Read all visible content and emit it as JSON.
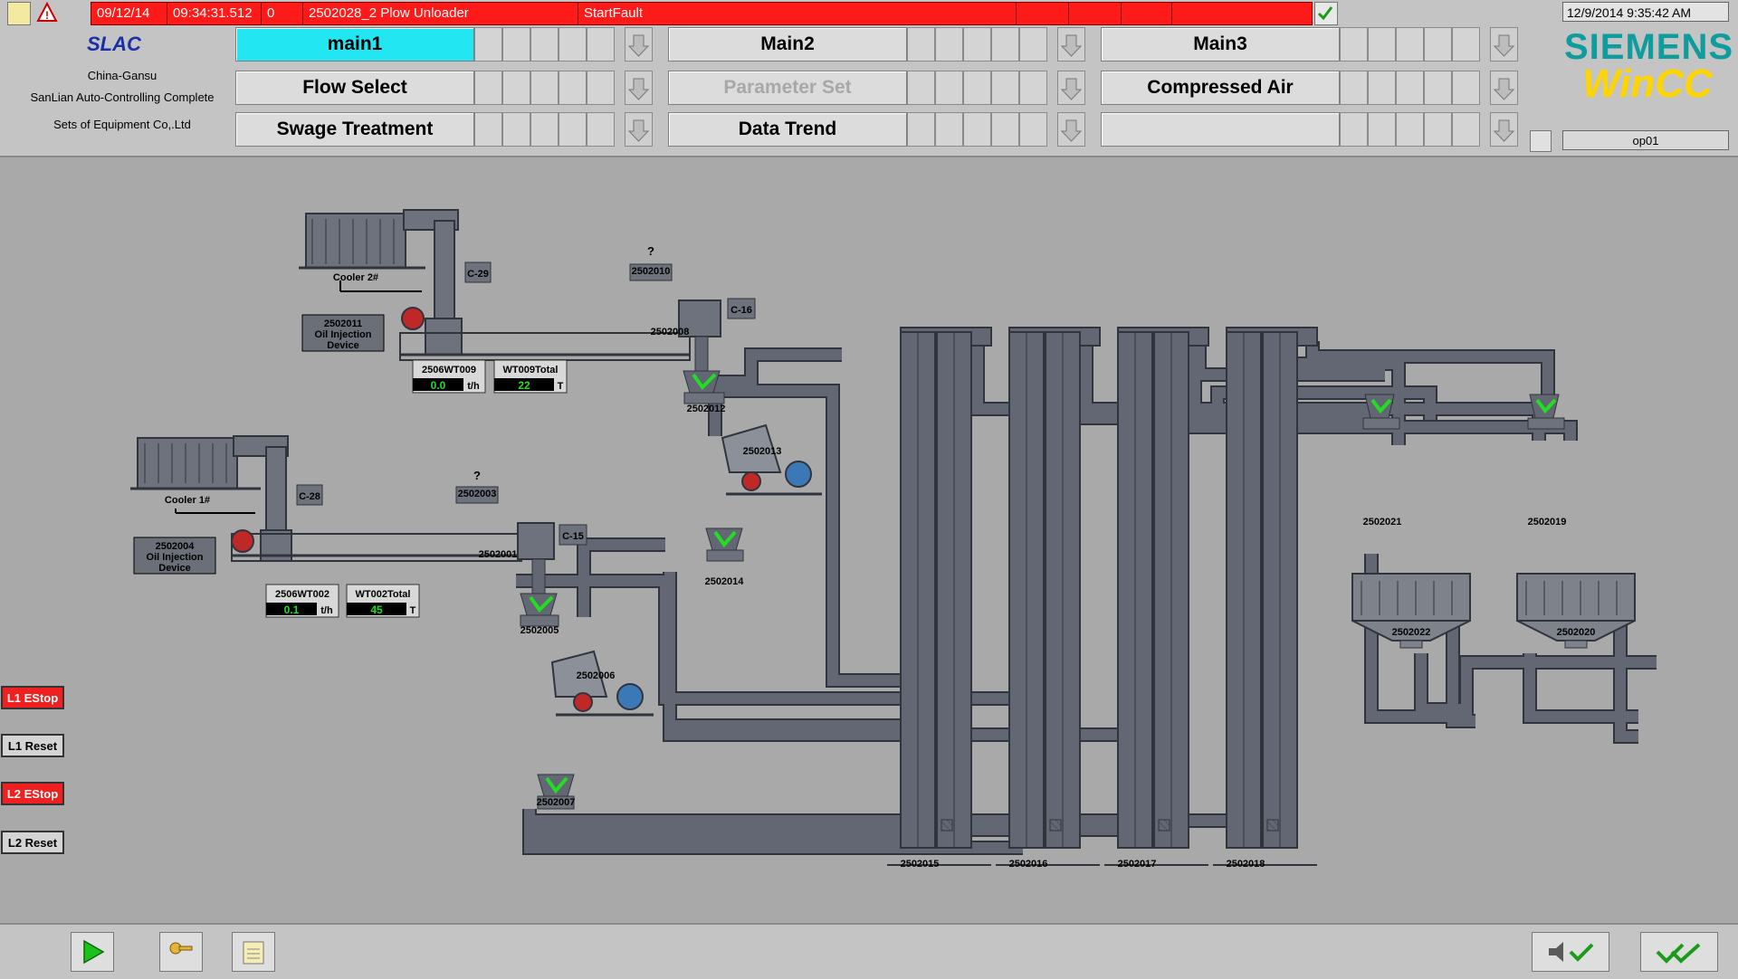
{
  "alarm_bar": {
    "date": "09/12/14",
    "time": "09:34:31.512",
    "state": "0",
    "message": "2502028_2 Plow Unloader",
    "event": "StartFault"
  },
  "branding": {
    "logo": "SLAC",
    "company_line1": "China-Gansu",
    "company_line2": "SanLian Auto-Controlling Complete",
    "company_line3": "Sets of Equipment Co,.Ltd",
    "vendor": "SIEMENS",
    "product": "WinCC"
  },
  "nav": {
    "main1": "main1",
    "main2": "Main2",
    "main3": "Main3",
    "flow_select": "Flow Select",
    "parameter_set": "Parameter Set",
    "compressed_air": "Compressed Air",
    "swage_treatment": "Swage Treatment",
    "data_trend": "Data Trend"
  },
  "system": {
    "datetime": "12/9/2014 9:35:42 AM",
    "station": "op01"
  },
  "process": {
    "cooler2": "Cooler 2#",
    "cooler1": "Cooler 1#",
    "c29": "C-29",
    "c28": "C-28",
    "c16": "C-16",
    "c15": "C-15",
    "oil2_id": "2502011",
    "oil2_l1": "Oil Injection",
    "oil2_l2": "Device",
    "oil1_id": "2502004",
    "oil1_l1": "Oil Injection",
    "oil1_l2": "Device",
    "wt009_label": "2506WT009",
    "wt009_value": "0.0",
    "wt009_unit": "t/h",
    "wt009t_label": "WT009Total",
    "wt009t_value": "22",
    "wt009t_unit": "T",
    "wt002_label": "2506WT002",
    "wt002_value": "0.1",
    "wt002_unit": "t/h",
    "wt002t_label": "WT002Total",
    "wt002t_value": "45",
    "wt002t_unit": "T",
    "q_mark": "?",
    "d2502010": "2502010",
    "d2502008": "2502008",
    "d2502012": "2502012",
    "d2502013": "2502013",
    "d2502014": "2502014",
    "d2502003": "2502003",
    "d2502001": "2502001",
    "d2502005": "2502005",
    "d2502006": "2502006",
    "d2502007": "2502007",
    "d2502015": "2502015",
    "d2502016": "2502016",
    "d2502017": "2502017",
    "d2502018": "2502018",
    "d2502021": "2502021",
    "d2502019": "2502019",
    "d2502022": "2502022",
    "d2502020": "2502020"
  },
  "side_buttons": {
    "l1_estop": "L1 EStop",
    "l1_reset": "L1 Reset",
    "l2_estop": "L2 EStop",
    "l2_reset": "L2 Reset"
  },
  "colors": {
    "alarm": "#ff1a1a",
    "active_tab": "#22e6f2",
    "estop": "#f02020",
    "running_indicator": "#22dd22",
    "background": "#a9a9a9"
  }
}
